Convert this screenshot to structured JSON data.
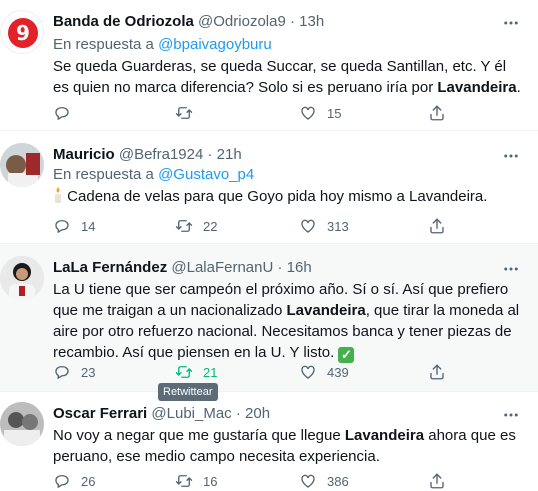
{
  "colors": {
    "accent": "#1d9bf0",
    "retweet_active": "#00ba7c",
    "muted": "#536471"
  },
  "tooltip": "Retwittear",
  "tweets": [
    {
      "name": "Banda de Odriozola",
      "handle": "@Odriozola9",
      "sep": "·",
      "time": "13h",
      "reply_prefix": "En respuesta a ",
      "reply_to": "@bpaivagoyburu",
      "text_parts": [
        "Se queda Guarderas, se queda Succar, se queda Santillan, etc. Y él es quien no marca diferencia? Solo si es peruano iría por ",
        "Lavandeira",
        "."
      ],
      "replies": "",
      "retweets": "",
      "likes": "15",
      "avatar_text": "9"
    },
    {
      "name": "Mauricio",
      "handle": "@Befra1924",
      "sep": "·",
      "time": "21h",
      "reply_prefix": "En respuesta a ",
      "reply_to": "@Gustavo_p4",
      "text": "Cadena de velas para que Goyo pida hoy mismo a Lavandeira.",
      "replies": "14",
      "retweets": "22",
      "likes": "313"
    },
    {
      "name": "LaLa Fernández",
      "handle": "@LalaFernanU",
      "sep": "·",
      "time": "16h",
      "text_parts": [
        "La U tiene que ser campeón el próximo año. Sí o sí. Así que prefiero que me traigan a un nacionalizado ",
        "Lavandeira",
        ", que tirar la moneda al aire por otro refuerzo nacional. Necesitamos banca y tener piezas de recambio. Así que piensen en la U. Y listo. "
      ],
      "check": "✓",
      "replies": "23",
      "retweets": "21",
      "likes": "439"
    },
    {
      "name": "Oscar Ferrari",
      "handle": "@Lubi_Mac",
      "sep": "·",
      "time": "20h",
      "text_parts": [
        "No voy a negar que me gustaría que llegue ",
        "Lavandeira",
        " ahora que es peruano, ese medio campo necesita experiencia."
      ],
      "replies": "26",
      "retweets": "16",
      "likes": "386"
    }
  ]
}
